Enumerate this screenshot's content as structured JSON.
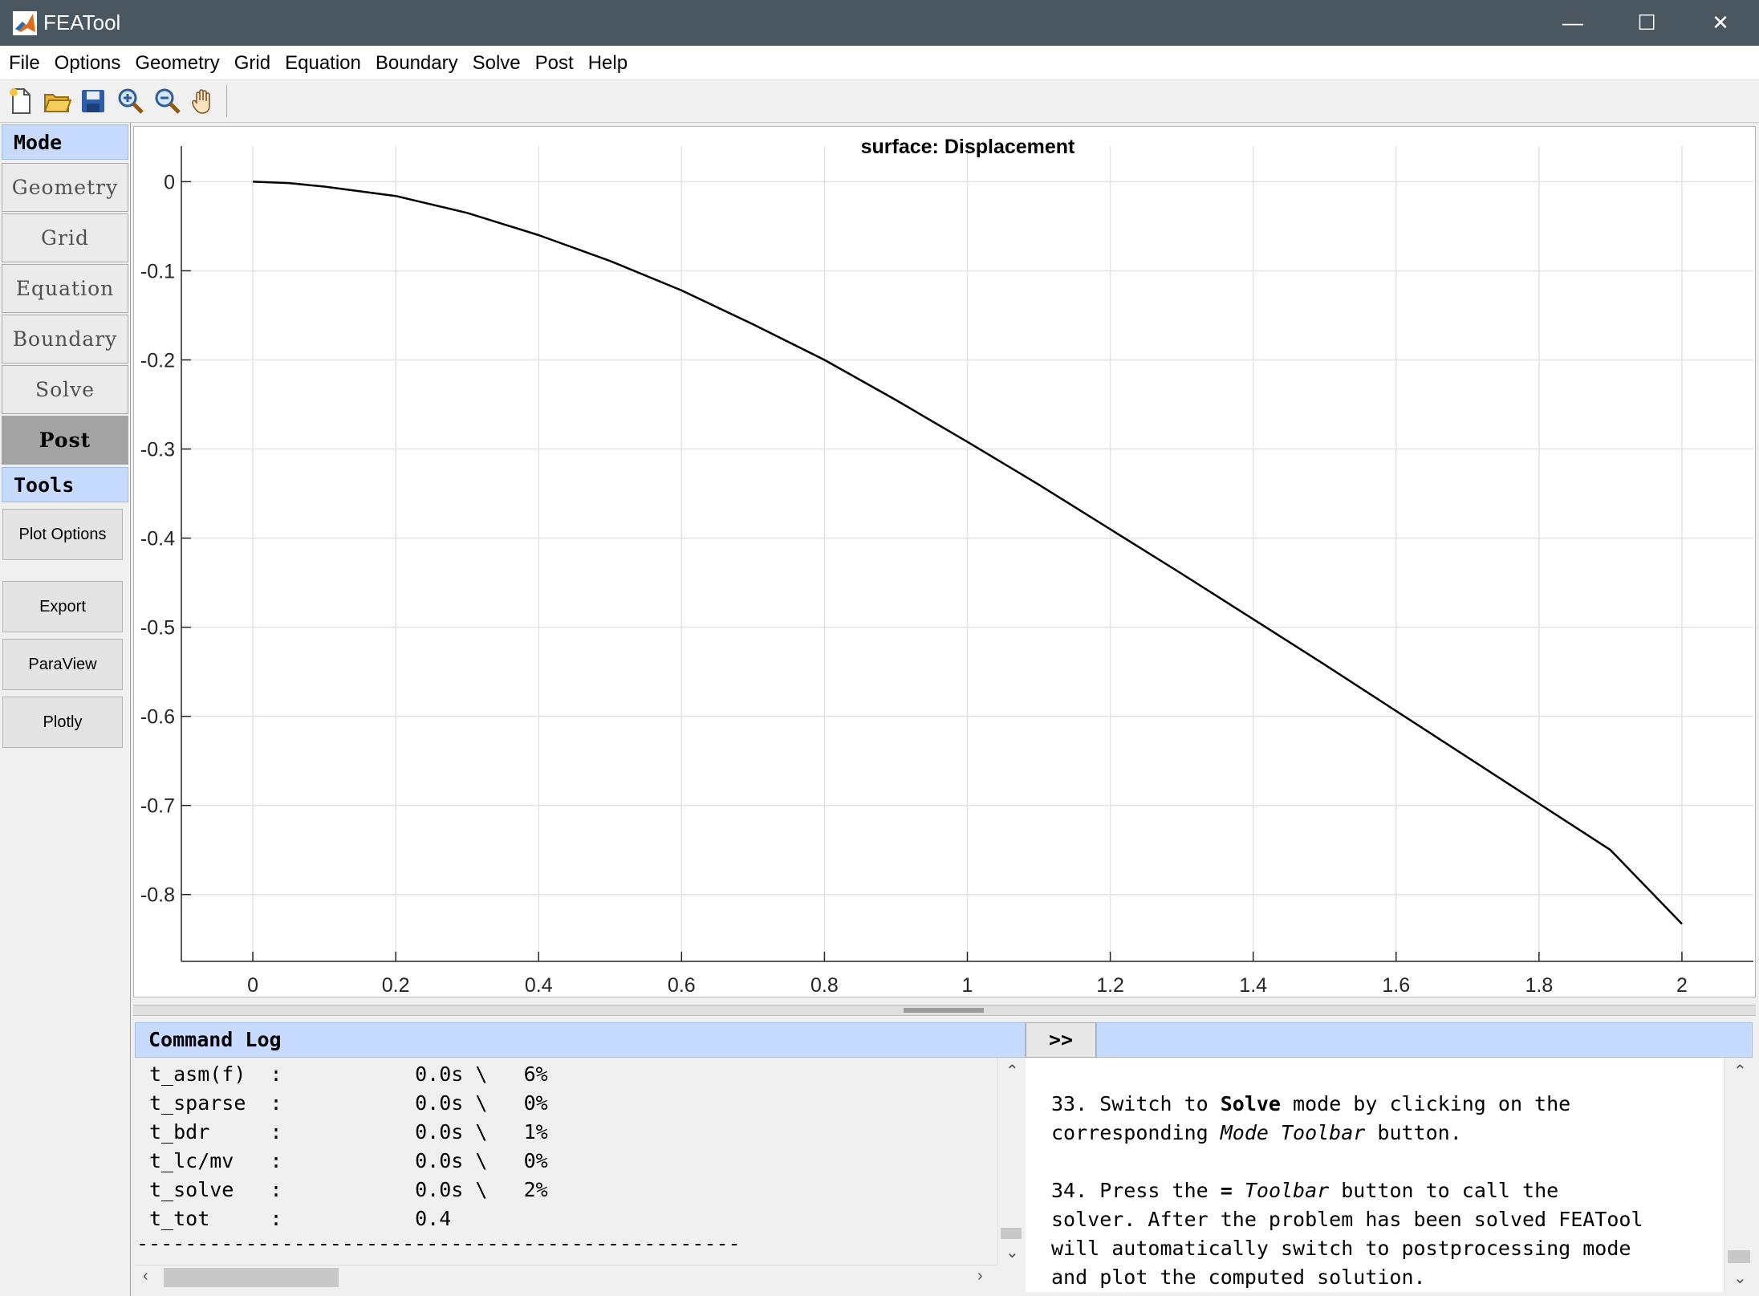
{
  "window": {
    "title": "FEATool",
    "app_icon": "matlab-icon"
  },
  "menu": [
    "File",
    "Options",
    "Geometry",
    "Grid",
    "Equation",
    "Boundary",
    "Solve",
    "Post",
    "Help"
  ],
  "toolbar": [
    "new-file-icon",
    "open-folder-icon",
    "save-icon",
    "zoom-in-icon",
    "zoom-out-icon",
    "pan-hand-icon"
  ],
  "sidebar": {
    "mode_header": "Mode",
    "modes": [
      "Geometry",
      "Grid",
      "Equation",
      "Boundary",
      "Solve",
      "Post"
    ],
    "active_mode": "Post",
    "tools_header": "Tools",
    "tools": [
      "Plot Options",
      "Export",
      "ParaView",
      "Plotly"
    ]
  },
  "chart_data": {
    "type": "line",
    "title": "surface: Displacement",
    "xlabel": "",
    "ylabel": "",
    "xlim": [
      -0.1,
      2.1
    ],
    "ylim": [
      -0.875,
      0.04
    ],
    "xticks": [
      0,
      0.2,
      0.4,
      0.6,
      0.8,
      1,
      1.2,
      1.4,
      1.6,
      1.8,
      2
    ],
    "yticks": [
      0,
      -0.1,
      -0.2,
      -0.3,
      -0.4,
      -0.5,
      -0.6,
      -0.7,
      -0.8
    ],
    "grid": true,
    "series": [
      {
        "color": "#000000",
        "x": [
          0,
          0.05,
          0.1,
          0.2,
          0.3,
          0.4,
          0.5,
          0.6,
          0.7,
          0.8,
          0.9,
          1.0,
          1.1,
          1.2,
          1.3,
          1.4,
          1.5,
          1.6,
          1.7,
          1.8,
          1.9,
          2.0
        ],
        "y": [
          0,
          -0.0015,
          -0.0055,
          -0.016,
          -0.035,
          -0.06,
          -0.089,
          -0.122,
          -0.16,
          -0.2,
          -0.245,
          -0.292,
          -0.34,
          -0.39,
          -0.44,
          -0.491,
          -0.542,
          -0.594,
          -0.646,
          -0.698,
          -0.75,
          -0.833
        ]
      }
    ]
  },
  "command_log": {
    "header": "Command Log",
    "expand_label": ">>",
    "lines": [
      "t_asm(f)  :           0.0s \\   6%",
      "t_sparse  :           0.0s \\   0%",
      "t_bdr     :           0.0s \\   1%",
      "t_lc/mv   :           0.0s \\   0%",
      "t_solve   :           0.0s \\   2%",
      "t_tot     :           0.4",
      "--------------------------------------------------"
    ]
  },
  "tutorial": {
    "step33": {
      "l1a": "33. Switch to ",
      "l1b": "Solve",
      "l1c": " mode by clicking on the",
      "l2a": "corresponding ",
      "l2b": "Mode Toolbar",
      "l2c": " button."
    },
    "step34": {
      "l1a": "34. Press the ",
      "l1b": "=",
      "l1c": " ",
      "l1d": "Toolbar",
      "l1e": " button to call the",
      "l2": "solver. After the problem has been solved FEATool",
      "l3": "will automatically switch to postprocessing mode",
      "l4": "and plot the computed solution."
    }
  }
}
